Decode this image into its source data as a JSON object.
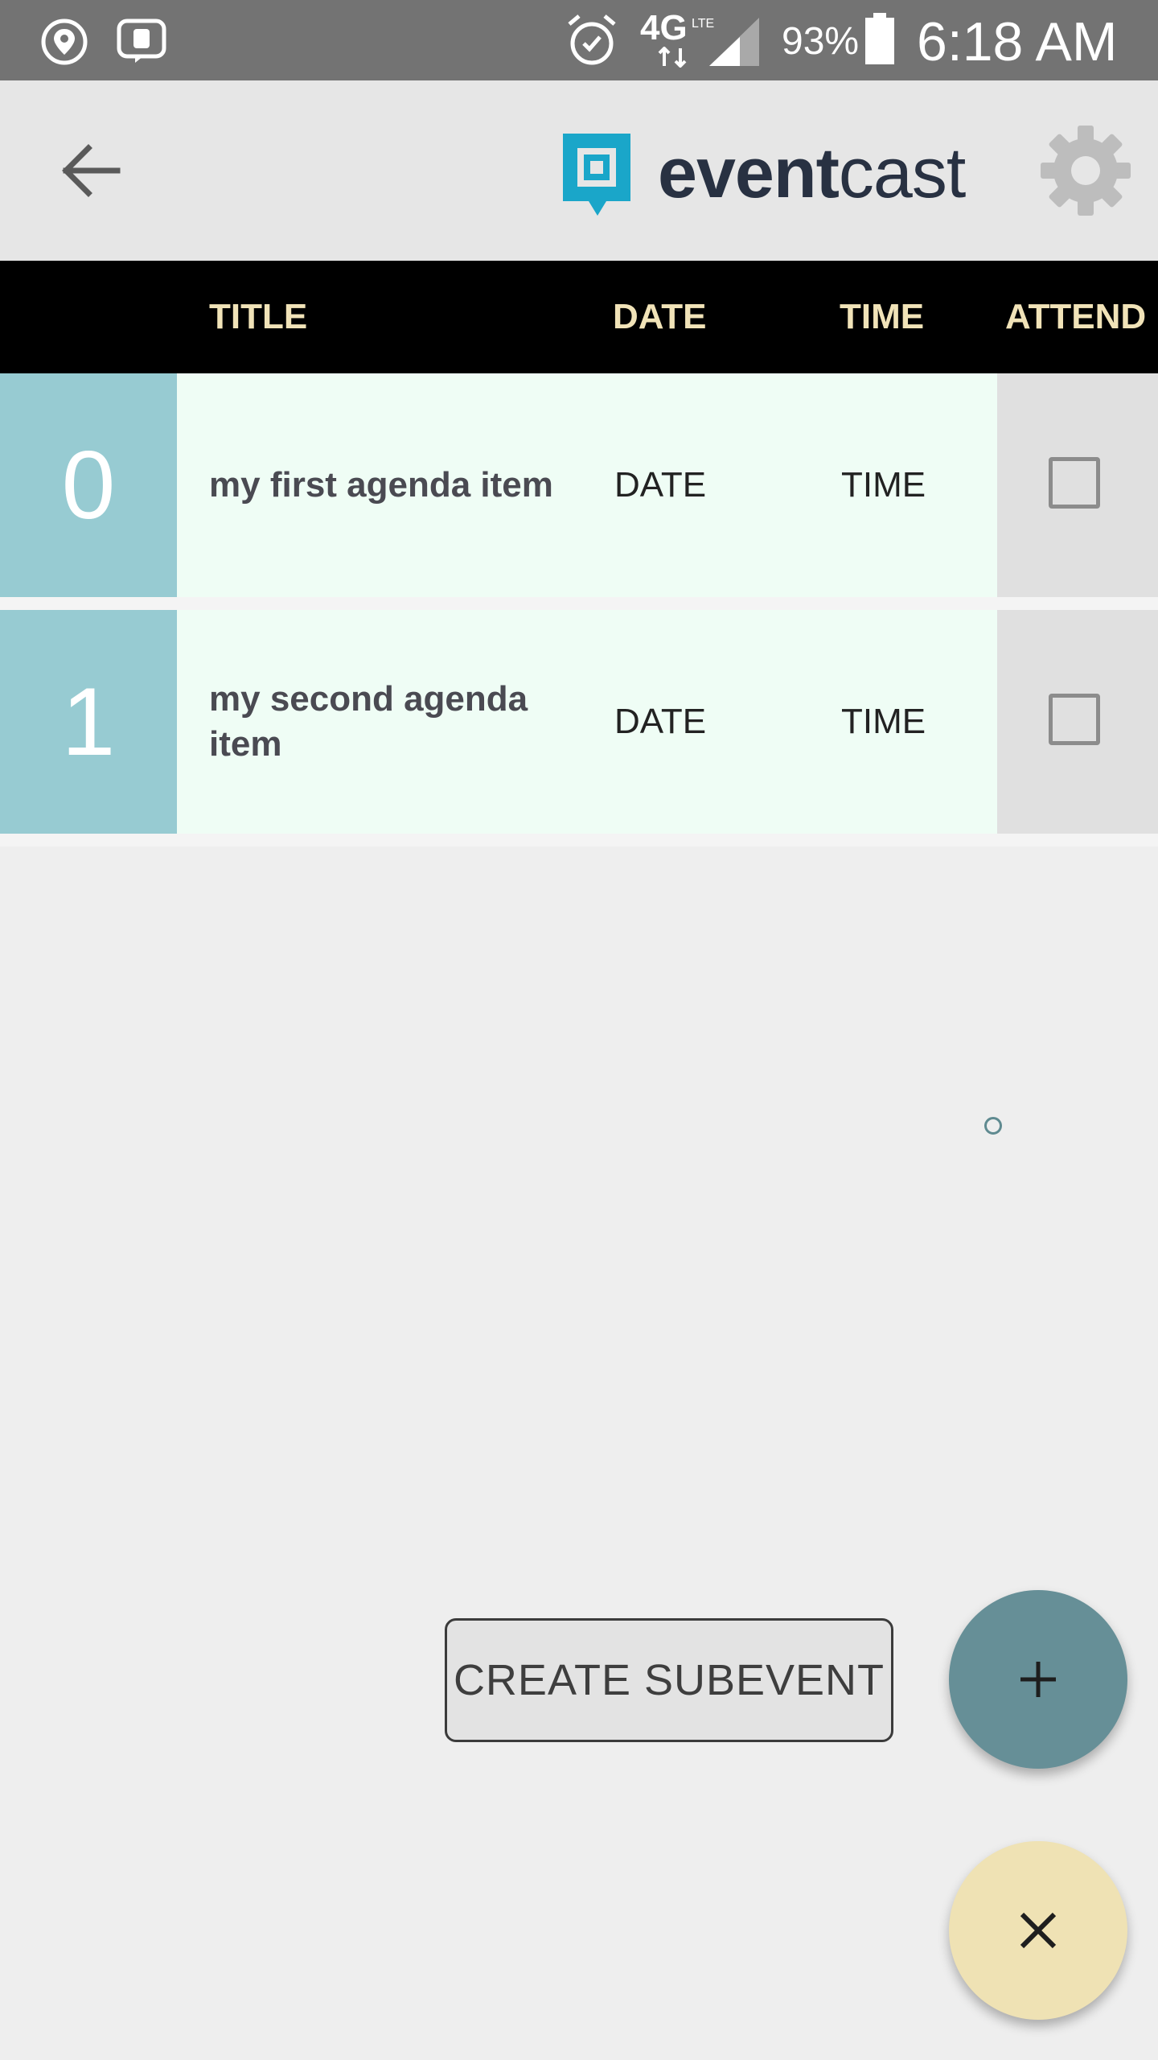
{
  "status_bar": {
    "network": "4G",
    "network_sub": "LTE",
    "battery": "93%",
    "time": "6:18 AM",
    "icons": [
      "location-icon",
      "voicemail-icon",
      "alarm-icon",
      "network-4g-lte-icon",
      "signal-icon",
      "battery-icon"
    ]
  },
  "app_bar": {
    "logo_bold": "event",
    "logo_light": "cast",
    "icons": [
      "back-arrow-icon",
      "eventcast-logo-icon",
      "gear-icon"
    ],
    "colors": {
      "logo": "#1aa6c9",
      "logo_text": "#283142"
    }
  },
  "table": {
    "headers": {
      "title": "TITLE",
      "date": "DATE",
      "time": "TIME",
      "attend": "ATTEND"
    },
    "rows": [
      {
        "index": "0",
        "title": "my first agenda item",
        "date": "DATE",
        "time": "TIME",
        "attending": false
      },
      {
        "index": "1",
        "title": "my second agenda item",
        "date": "DATE",
        "time": "TIME",
        "attending": false
      }
    ],
    "colors": {
      "header_bg": "#000000",
      "header_text": "#f1e3b8",
      "index_bg": "#97cbd2",
      "row_bg": "#effdf5"
    }
  },
  "actions": {
    "create_subevent": "CREATE SUBEVENT",
    "add_icon": "plus-icon",
    "close_icon": "close-icon",
    "colors": {
      "add_fab": "#668f97",
      "close_fab": "#efe2b4"
    }
  }
}
